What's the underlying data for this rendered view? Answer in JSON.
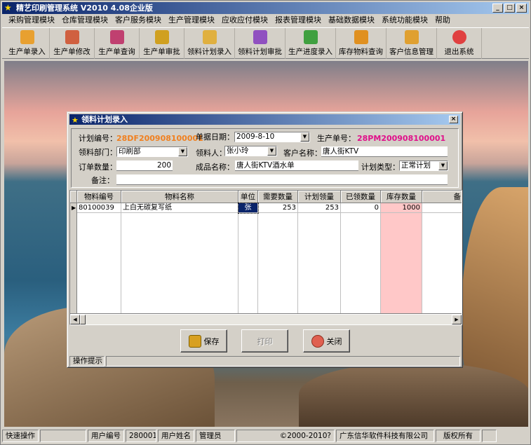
{
  "window": {
    "title": "精艺印刷管理系统  V2010  4.08企业版",
    "btn_min": "_",
    "btn_max": "□",
    "btn_close": "×"
  },
  "menu": [
    "采购管理模块",
    "仓库管理模块",
    "客户服务模块",
    "生产管理模块",
    "应收应付模块",
    "报表管理模块",
    "基础数据模块",
    "系统功能模块",
    "帮助"
  ],
  "toolbar": [
    {
      "label": "生产单录入",
      "color": "#e8a030"
    },
    {
      "label": "生产单修改",
      "color": "#d06040"
    },
    {
      "label": "生产单查询",
      "color": "#c04070"
    },
    {
      "label": "生产单审批",
      "color": "#d0a020"
    },
    {
      "label": "领料计划录入",
      "color": "#e0b040"
    },
    {
      "label": "领料计划审批",
      "color": "#9050c0"
    },
    {
      "label": "生产进度录入",
      "color": "#40a040"
    },
    {
      "label": "库存物料查询",
      "color": "#e09020"
    },
    {
      "label": "客户信息管理",
      "color": "#e0a030"
    },
    {
      "label": "退出系统",
      "color": "#e04040"
    }
  ],
  "dialog": {
    "title": "领料计划录入",
    "close": "×",
    "plan_no_label": "计划编号：",
    "plan_no": "28DF200908100001",
    "doc_date_label": "单据日期：",
    "doc_date": "2009-8-10",
    "prod_no_label": "生产单号：",
    "prod_no": "28PM200908100001",
    "dept_label": "领料部门：",
    "dept": "印刷部",
    "picker_label": "领料人：",
    "picker": "张小玲",
    "customer_label": "客户名称：",
    "customer": "唐人街KTV",
    "order_qty_label": "订单数量：",
    "order_qty": "200",
    "product_label": "成品名称：",
    "product": "唐人街KTV酒水单",
    "plan_type_label": "计划类型：",
    "plan_type": "正常计划",
    "remark_label": "备注：",
    "remark": "",
    "grid": {
      "headers": [
        "物料编号",
        "物料名称",
        "单位",
        "需要数量",
        "计划领量",
        "已领数量",
        "库存数量",
        "备"
      ],
      "rows": [
        {
          "code": "80100039",
          "name": "上白无碳复写纸",
          "unit": "张",
          "need": "253",
          "plan": "253",
          "received": "0",
          "stock": "1000"
        }
      ]
    },
    "buttons": {
      "save": "保存",
      "print": "打印",
      "close": "关闭"
    },
    "status_label": "操作提示",
    "status_text": ""
  },
  "statusbar": {
    "quick": "快速操作",
    "user_no_label": "用户编号",
    "user_no": "280001",
    "user_name_label": "用户姓名",
    "user_name": "管理员",
    "copyright": "©2000-2010?",
    "company": "广东信华软件科技有限公司",
    "rights": "版权所有"
  },
  "colors": {
    "accent_orange": "#f08020",
    "accent_pink": "#e0108a",
    "stock_bg": "#ffc8c8"
  }
}
